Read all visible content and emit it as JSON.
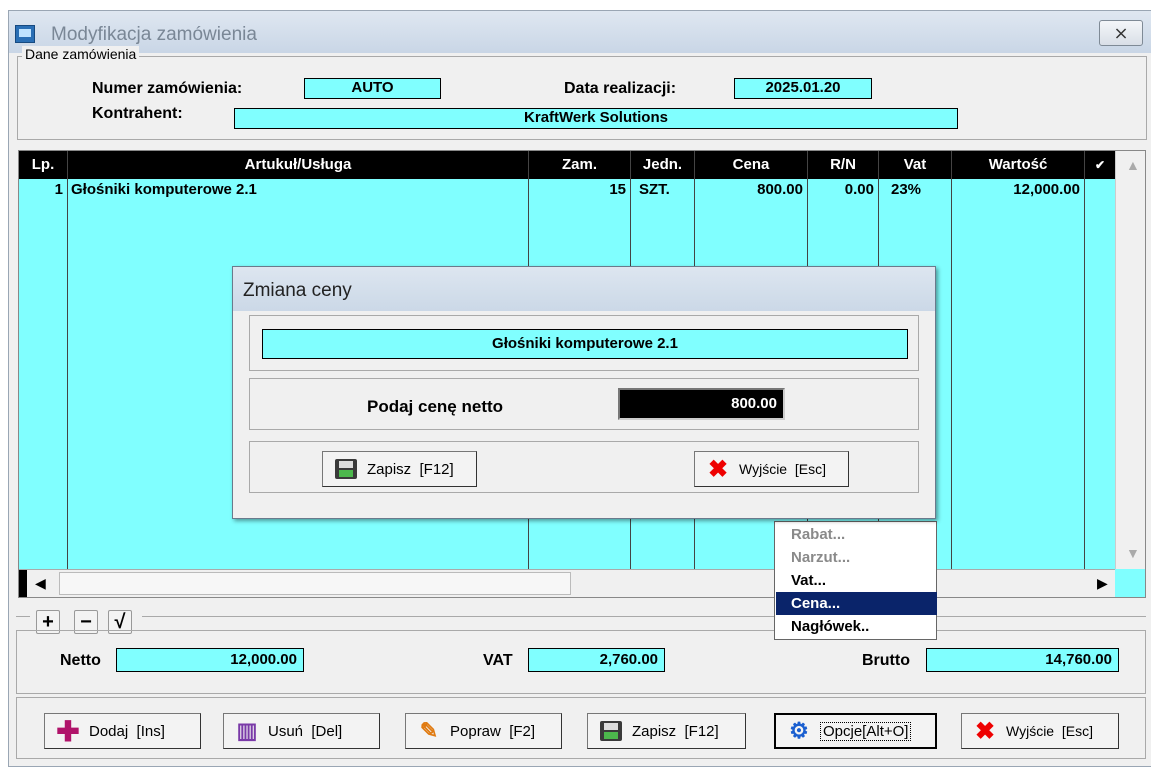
{
  "window": {
    "title": "Modyfikacja zamówienia",
    "close_label": "⨯"
  },
  "order": {
    "group_label": "Dane zamówienia",
    "number_label": "Numer zamówienia:",
    "number_value": "AUTO",
    "date_label": "Data realizacji:",
    "date_value": "2025.01.20",
    "client_label": "Kontrahent:",
    "client_value": "KraftWerk Solutions"
  },
  "grid": {
    "columns": [
      "Lp.",
      "Artukuł/Usługa",
      "Zam.",
      "Jedn.",
      "Cena",
      "R/N",
      "Vat",
      "Wartość",
      "✔"
    ],
    "rows": [
      {
        "lp": "1",
        "item": "Głośniki komputerowe 2.1",
        "qty": "15",
        "unit": "SZT.",
        "price": "800.00",
        "rn": "0.00",
        "vat": "23%",
        "value": "12,000.00"
      }
    ]
  },
  "small_buttons": {
    "add": "+",
    "remove": "−",
    "confirm": "√"
  },
  "totals": {
    "netto_label": "Netto",
    "netto_value": "12,000.00",
    "vat_label": "VAT",
    "vat_value": "2,760.00",
    "brutto_label": "Brutto",
    "brutto_value": "14,760.00"
  },
  "buttons": {
    "add": "Dodaj  [Ins]",
    "delete": "Usuń  [Del]",
    "edit": "Popraw  [F2]",
    "save": "Zapisz  [F12]",
    "options": "Opcje[Alt+O]",
    "exit": "Wyjście  [Esc]"
  },
  "context_menu": {
    "items": [
      {
        "label": "Rabat...",
        "enabled": false
      },
      {
        "label": "Narzut...",
        "enabled": false
      },
      {
        "label": "Vat...",
        "enabled": true
      },
      {
        "label": "Cena...",
        "enabled": true,
        "selected": true
      },
      {
        "label": "Nagłówek..",
        "enabled": true
      }
    ]
  },
  "dialog": {
    "title": "Zmiana ceny",
    "product": "Głośniki komputerowe 2.1",
    "price_label": "Podaj cenę netto",
    "price_value": "800.00",
    "save_label": "Zapisz  [F12]",
    "exit_label": "Wyjście  [Esc]"
  },
  "colors": {
    "accent_cyan": "#80ffff",
    "selection": "#0a246a",
    "danger": "#e00000"
  }
}
